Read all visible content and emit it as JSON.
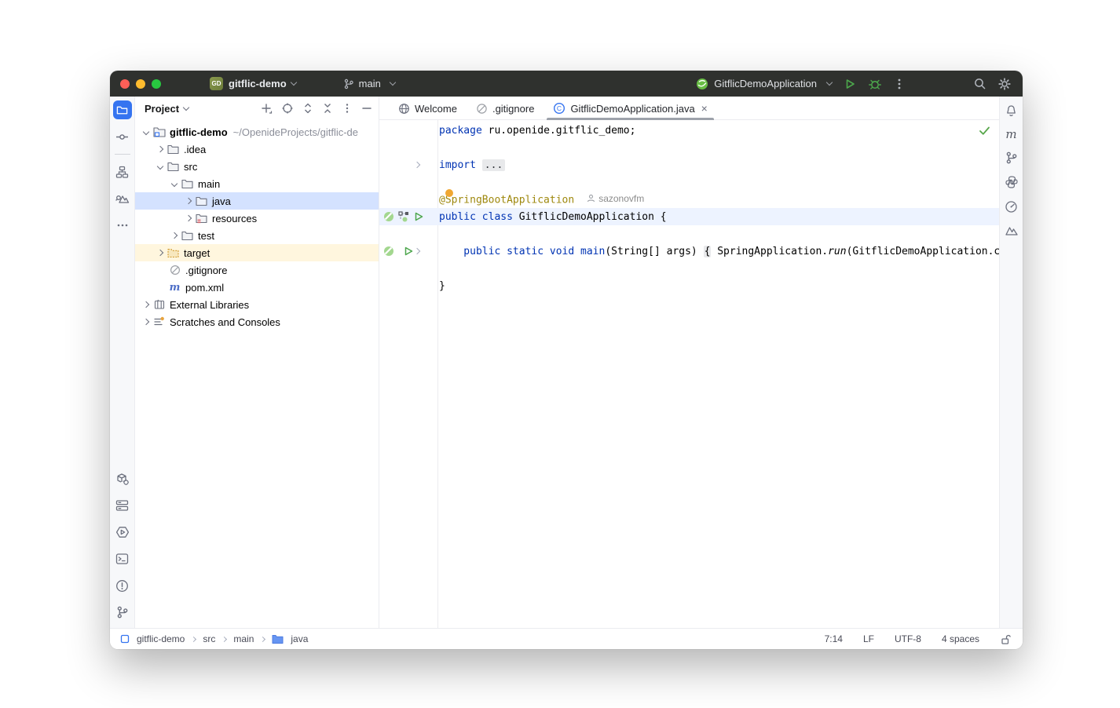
{
  "titlebar": {
    "project_badge": "GD",
    "project_name": "gitflic-demo",
    "branch_name": "main",
    "run_config": "GitflicDemoApplication"
  },
  "project_panel": {
    "title": "Project",
    "tree": {
      "items": [
        {
          "label": "gitflic-demo",
          "path": "~/OpenideProjects/gitflic-de"
        },
        {
          "label": ".idea"
        },
        {
          "label": "src"
        },
        {
          "label": "main"
        },
        {
          "label": "java"
        },
        {
          "label": "resources"
        },
        {
          "label": "test"
        },
        {
          "label": "target"
        },
        {
          "label": ".gitignore"
        },
        {
          "label": "pom.xml"
        },
        {
          "label": "External Libraries"
        },
        {
          "label": "Scratches and Consoles"
        }
      ]
    }
  },
  "tabs": {
    "items": [
      {
        "label": "Welcome"
      },
      {
        "label": ".gitignore"
      },
      {
        "label": "GitflicDemoApplication.java"
      }
    ],
    "close_glyph": "×"
  },
  "code": {
    "l1": {
      "kw": "package",
      "rest": " ru.openide.gitflic_demo;"
    },
    "l2": {
      "kw": "import ",
      "fold": "..."
    },
    "l3": {
      "ann": "@SpringBootApplication",
      "author": "sazonovfm"
    },
    "l4": {
      "kw": "public class",
      "rest": " GitflicDemoApplication {"
    },
    "l5": {
      "kw": "    public static void main",
      "args": "(String[] args) ",
      "brace": "{",
      "mid": " SpringApplication.",
      "method": "run",
      "rest": "(GitflicDemoApplication.cl"
    },
    "l6": {
      "brace": "}"
    }
  },
  "status_bar": {
    "breadcrumbs": [
      "gitflic-demo",
      "src",
      "main",
      "java"
    ],
    "line_col": "7:14",
    "line_separator": "LF",
    "encoding": "UTF-8",
    "indent": "4 spaces"
  },
  "icons": {
    "maven_letter": "m",
    "class_letter": "C"
  },
  "colors": {
    "accent_blue": "#3574F0",
    "selection_blue": "#D4E2FF",
    "excluded_yellow": "#FFF6DE",
    "keyword_blue": "#0033B3",
    "annotation_olive": "#9E880D",
    "run_green": "#4CA64C",
    "titlebar_dark": "#2F312E"
  }
}
